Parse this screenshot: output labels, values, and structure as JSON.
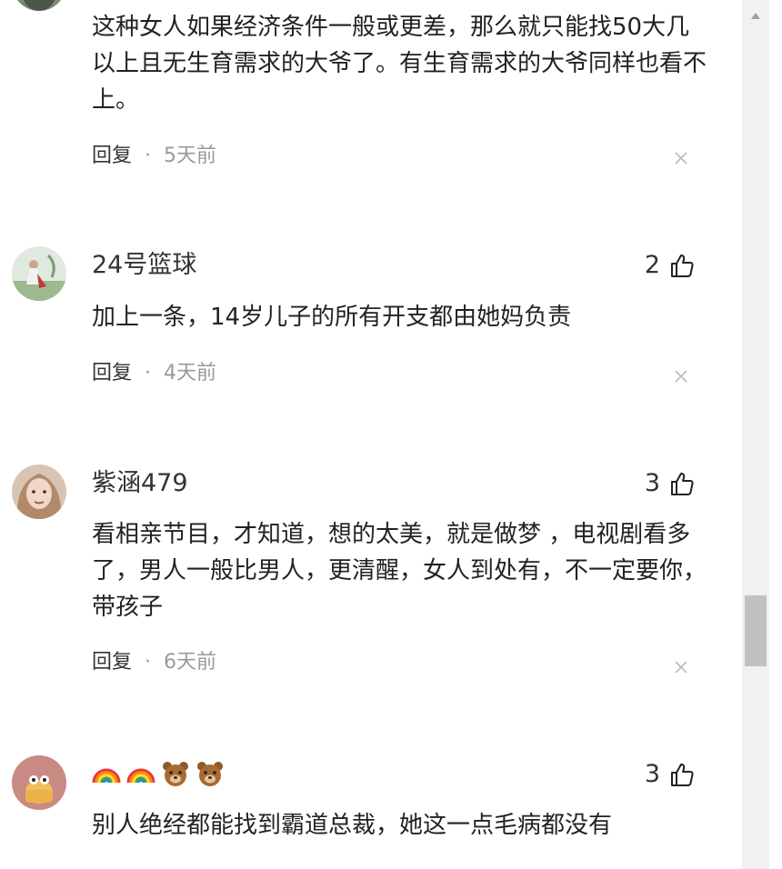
{
  "scrollbar": {
    "up_arrow_icon": "triangle-up",
    "thumb_position_percent": 71
  },
  "comments": [
    {
      "text": "这种女人如果经济条件一般或更差，那么就只能找50大几以上且无生育需求的大爷了。有生育需求的大爷同样也看不上。",
      "reply_label": "回复",
      "dot": "·",
      "time": "5天前",
      "close_icon": "close-icon"
    },
    {
      "username": "24号篮球",
      "likes": "2",
      "text": "加上一条，14岁儿子的所有开支都由她妈负责",
      "reply_label": "回复",
      "dot": "·",
      "time": "4天前",
      "close_icon": "close-icon"
    },
    {
      "username": "紫涵479",
      "likes": "3",
      "text": "看相亲节目，才知道，想的太美，就是做梦 ，电视剧看多了，男人一般比男人，更清醒，女人到处有，不一定要你，带孩子",
      "reply_label": "回复",
      "dot": "·",
      "time": "6天前",
      "close_icon": "close-icon"
    },
    {
      "username_emojis": [
        "rainbow",
        "rainbow",
        "bear-face",
        "bear-face"
      ],
      "likes": "3",
      "text": "别人绝经都能找到霸道总裁，她这一点毛病都没有"
    }
  ]
}
